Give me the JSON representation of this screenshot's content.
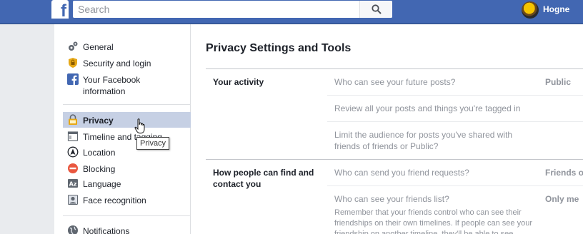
{
  "topbar": {
    "search_placeholder": "Search",
    "user_name": "Hogne",
    "brand_color": "#4267b2"
  },
  "sidebar": {
    "items": [
      {
        "label": "General",
        "icon": "gear-icon"
      },
      {
        "label": "Security and login",
        "icon": "shield-icon"
      },
      {
        "label": "Your Facebook information",
        "icon": "facebook-icon"
      },
      {
        "label": "Privacy",
        "icon": "lock-icon",
        "selected": true
      },
      {
        "label": "Timeline and tagging",
        "icon": "timeline-icon"
      },
      {
        "label": "Location",
        "icon": "location-icon"
      },
      {
        "label": "Blocking",
        "icon": "block-icon"
      },
      {
        "label": "Language",
        "icon": "language-icon"
      },
      {
        "label": "Face recognition",
        "icon": "face-recognition-icon"
      },
      {
        "label": "Notifications",
        "icon": "globe-icon"
      }
    ],
    "tooltip": "Privacy"
  },
  "main": {
    "title": "Privacy Settings and Tools",
    "sections": [
      {
        "label": "Your activity",
        "rows": [
          {
            "question": "Who can see your future posts?",
            "value": "Public"
          },
          {
            "question": "Review all your posts and things you're tagged in",
            "value": ""
          },
          {
            "question": "Limit the audience for posts you've shared with friends of friends or Public?",
            "value": ""
          }
        ]
      },
      {
        "label": "How people can find and contact you",
        "rows": [
          {
            "question": "Who can send you friend requests?",
            "value": "Friends of"
          },
          {
            "question": "Who can see your friends list?",
            "value": "Only me",
            "note": "Remember that your friends control who can see their friendships on their own timelines. If people can see your friendship on another timeline, they'll be able to see"
          }
        ]
      }
    ]
  }
}
